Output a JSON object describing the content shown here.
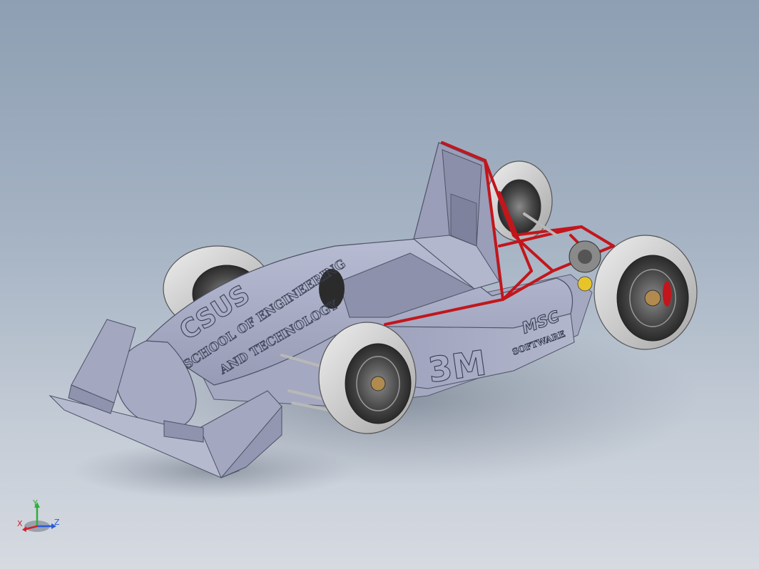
{
  "viewport": {
    "background_top": "#8e9fb3",
    "background_bottom": "#d6dae1"
  },
  "model": {
    "body_color": "#a9adc6",
    "frame_color": "#c2161c",
    "tire_color": "#d6d6d6",
    "decals": {
      "logo": "CSUS",
      "school_line1": "SCHOOL OF ENGINEERING",
      "school_line2": "AND TECHNOLOGY",
      "sponsor_3m": "3M",
      "sponsor_msc_top": "MSC",
      "sponsor_msc_bottom": "SOFTWARE"
    }
  },
  "triad": {
    "x_label": "X",
    "y_label": "Y",
    "z_label": "Z",
    "x_color": "#d0202a",
    "y_color": "#2fae3a",
    "z_color": "#2a5bd7"
  }
}
